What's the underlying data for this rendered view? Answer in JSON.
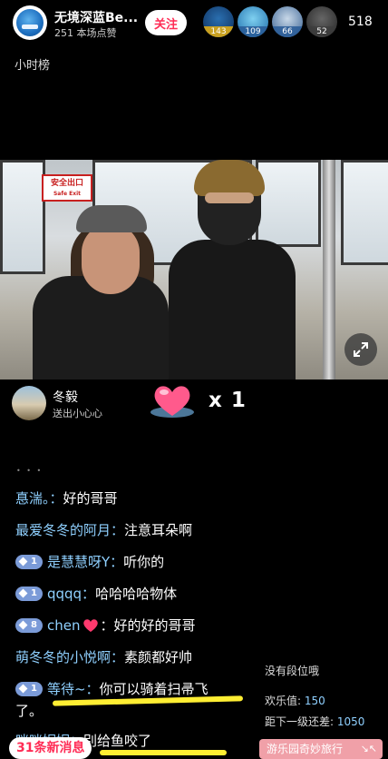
{
  "host": {
    "name": "无境深蓝Be...",
    "likes_text": "251 本场点赞",
    "follow_label": "关注"
  },
  "viewers": {
    "badges": [
      "143",
      "109",
      "66",
      "52"
    ],
    "count": "518"
  },
  "hourly_rank_label": "小时榜",
  "video": {
    "exit_sign_cn": "安全出口",
    "exit_sign_en": "Safe Exit"
  },
  "gift": {
    "sender_name": "冬毅",
    "action": "送出小心心",
    "count": "x 1"
  },
  "chat": {
    "messages": [
      {
        "name": "惪湍。：",
        "text": "好的哥哥"
      },
      {
        "name": "最爱冬冬的阿月：",
        "text": "注意耳朵啊"
      },
      {
        "level": "1",
        "name": "是慧慧呀Y：",
        "text": "听你的"
      },
      {
        "level": "1",
        "name": "qqqq：",
        "text": "哈哈哈哈物体"
      },
      {
        "level": "8",
        "name": "chen",
        "text": "：好的好的哥哥"
      },
      {
        "name": "萌冬冬的小悦啊：",
        "text": "素颜都好帅"
      },
      {
        "level": "1",
        "name": "等待~：",
        "text": "你可以骑着扫帚飞"
      },
      {
        "text": "了。"
      },
      {
        "name": "咪咪妮妮：",
        "text": "别给鱼咬了"
      }
    ],
    "new_messages_label": "31条新消息"
  },
  "rank_panel": {
    "no_rank": "没有段位哦",
    "joy_label": "欢乐值:",
    "joy_value": "150",
    "gap_label": "距下一级还差:",
    "gap_value": "1050"
  },
  "promo": {
    "label": "游乐园奇妙旅行"
  },
  "colors": {
    "follow_text": "#ff2c55",
    "chat_name": "#8fd0ff",
    "level_badge": "#7b9bd8",
    "highlight": "#ffee33",
    "promo_bg": "#f0a0a8"
  }
}
